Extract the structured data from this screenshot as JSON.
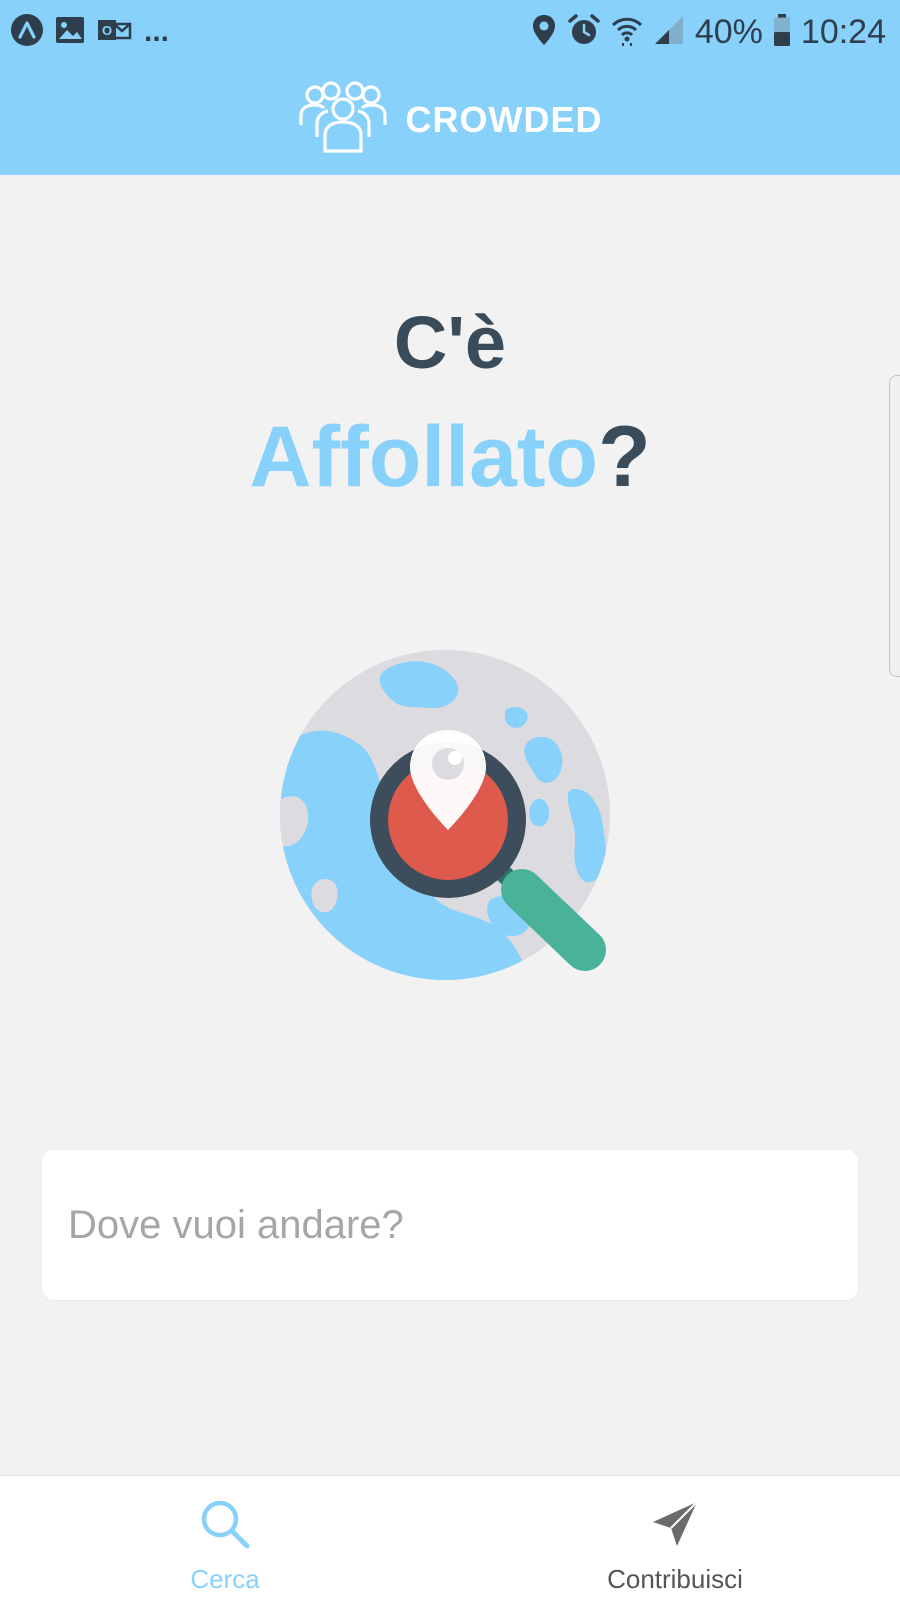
{
  "status_bar": {
    "left_icons": [
      "app-icon",
      "image-icon",
      "outlook-icon"
    ],
    "more_indicator": "...",
    "battery_percent": "40%",
    "time": "10:24"
  },
  "app_bar": {
    "logo_icon": "people-group-icon",
    "title": "CROWDED"
  },
  "hero": {
    "line1": "C'è",
    "line2_accent": "Affollato",
    "line2_suffix": "?",
    "illustration_icon": "globe-search-icon"
  },
  "search": {
    "placeholder": "Dove vuoi andare?",
    "value": ""
  },
  "bottom_nav": {
    "items": [
      {
        "label": "Cerca",
        "icon": "search-icon",
        "active": true
      },
      {
        "label": "Contribuisci",
        "icon": "send-icon",
        "active": false
      }
    ]
  },
  "colors": {
    "header_bg": "#87d1fb",
    "accent": "#87d1fb",
    "dark_text": "#3a4b5a",
    "page_bg": "#f2f2f2"
  }
}
